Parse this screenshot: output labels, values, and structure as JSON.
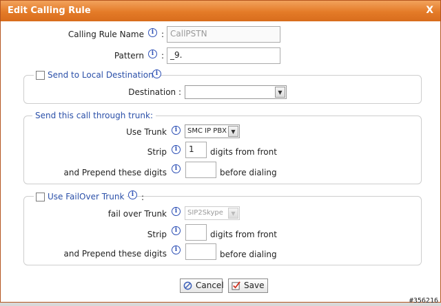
{
  "dialog": {
    "title": "Edit Calling Rule",
    "close": "X"
  },
  "rule_name": {
    "label": "Calling Rule Name",
    "value": "CallPSTN"
  },
  "pattern": {
    "label": "Pattern",
    "value": "_9."
  },
  "local_dest": {
    "legend": "Send to Local Destination",
    "destination_label": "Destination :",
    "destination_value": ""
  },
  "trunk": {
    "legend": "Send this call through trunk:",
    "use_trunk_label": "Use Trunk",
    "use_trunk_value": "SMC IP PBX",
    "strip_label": "Strip",
    "strip_value": "1",
    "strip_suffix": "digits from front",
    "prepend_label": "and Prepend these digits",
    "prepend_value": "",
    "prepend_suffix": "before dialing"
  },
  "failover": {
    "legend": "Use FailOver Trunk",
    "legend_colon": ":",
    "trunk_label": "fail over Trunk",
    "trunk_value": "SIP2Skype",
    "strip_label": "Strip",
    "strip_value": "",
    "strip_suffix": "digits from front",
    "prepend_label": "and Prepend these digits",
    "prepend_value": "",
    "prepend_suffix": "before dialing"
  },
  "buttons": {
    "cancel": "Cancel",
    "save": "Save"
  },
  "watermark": "#356216",
  "colors": {
    "titlebar": "#e47b28",
    "legend": "#2a4fa8",
    "info": "#2c4fb5"
  },
  "icons": {
    "info": "info-icon",
    "cancel": "cancel-icon",
    "save": "save-icon"
  }
}
